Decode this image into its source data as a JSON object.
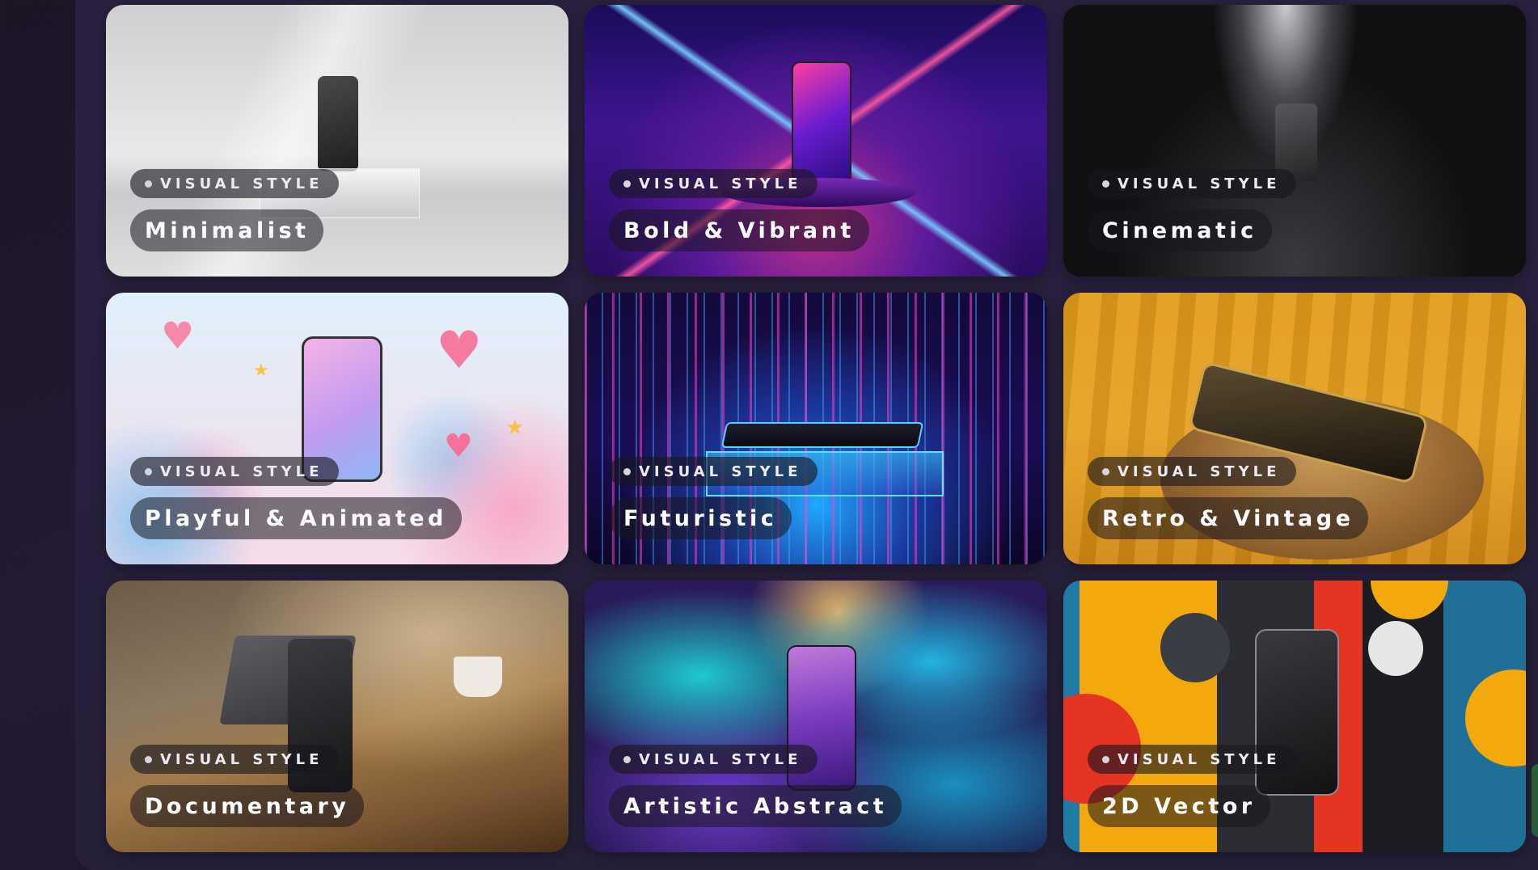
{
  "tag_label": "VISUAL STYLE",
  "cards": [
    {
      "title": "Minimalist"
    },
    {
      "title": "Bold & Vibrant"
    },
    {
      "title": "Cinematic"
    },
    {
      "title": "Playful & Animated"
    },
    {
      "title": "Futuristic"
    },
    {
      "title": "Retro & Vintage"
    },
    {
      "title": "Documentary"
    },
    {
      "title": "Artistic Abstract"
    },
    {
      "title": "2D Vector"
    }
  ]
}
